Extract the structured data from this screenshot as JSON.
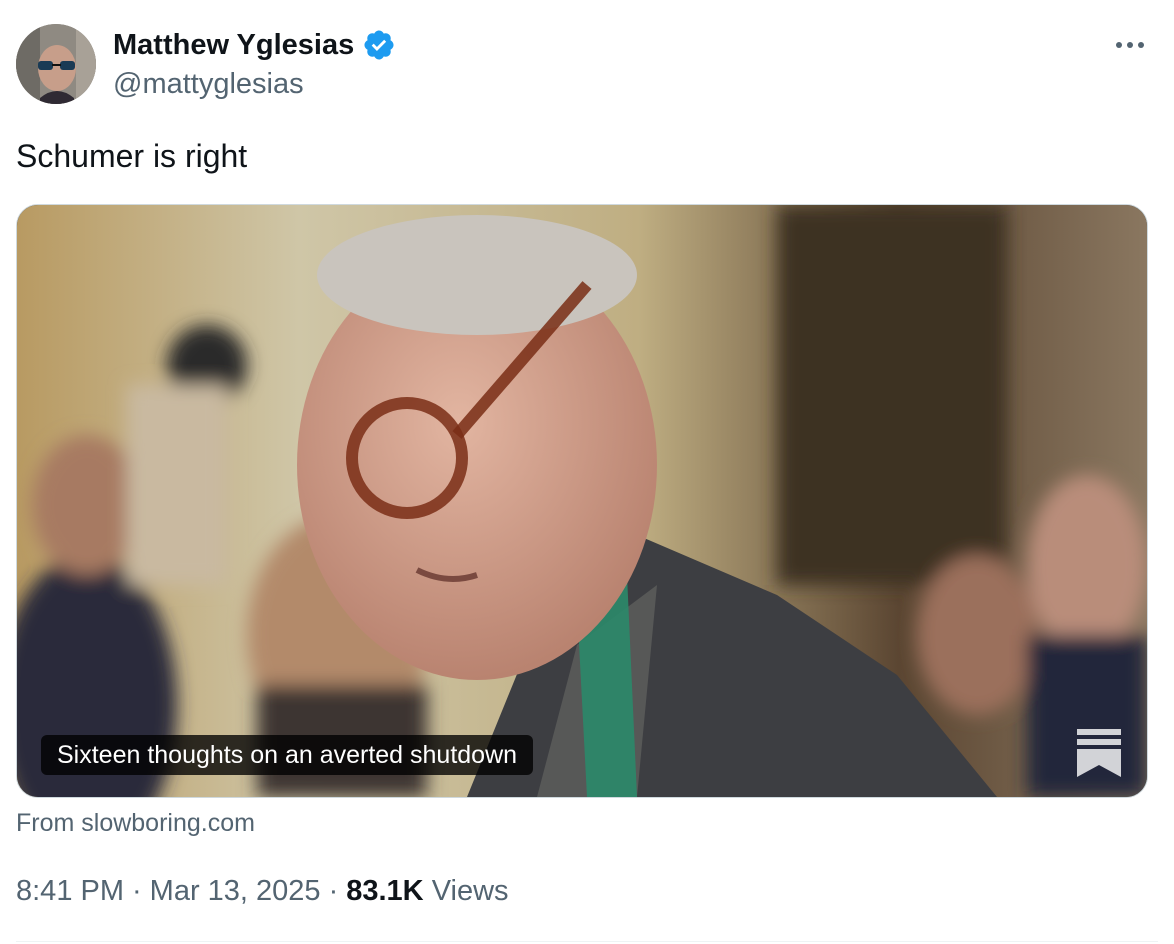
{
  "author": {
    "name": "Matthew Yglesias",
    "handle": "@mattyglesias",
    "verified": true
  },
  "tweet": {
    "text": "Schumer is right"
  },
  "card": {
    "caption": "Sixteen thoughts on an averted shutdown",
    "source": "From slowboring.com",
    "logo_icon": "substack-bookmark-icon"
  },
  "meta": {
    "time": "8:41 PM",
    "separator": "·",
    "date": "Mar 13, 2025",
    "views_count": "83.1K",
    "views_label": "Views"
  },
  "colors": {
    "text_primary": "#0f1419",
    "text_secondary": "#536471",
    "verified_blue": "#1d9bf0",
    "border": "#cfd9de"
  },
  "icons": {
    "more": "ellipsis-icon",
    "verified": "verified-badge-icon"
  }
}
